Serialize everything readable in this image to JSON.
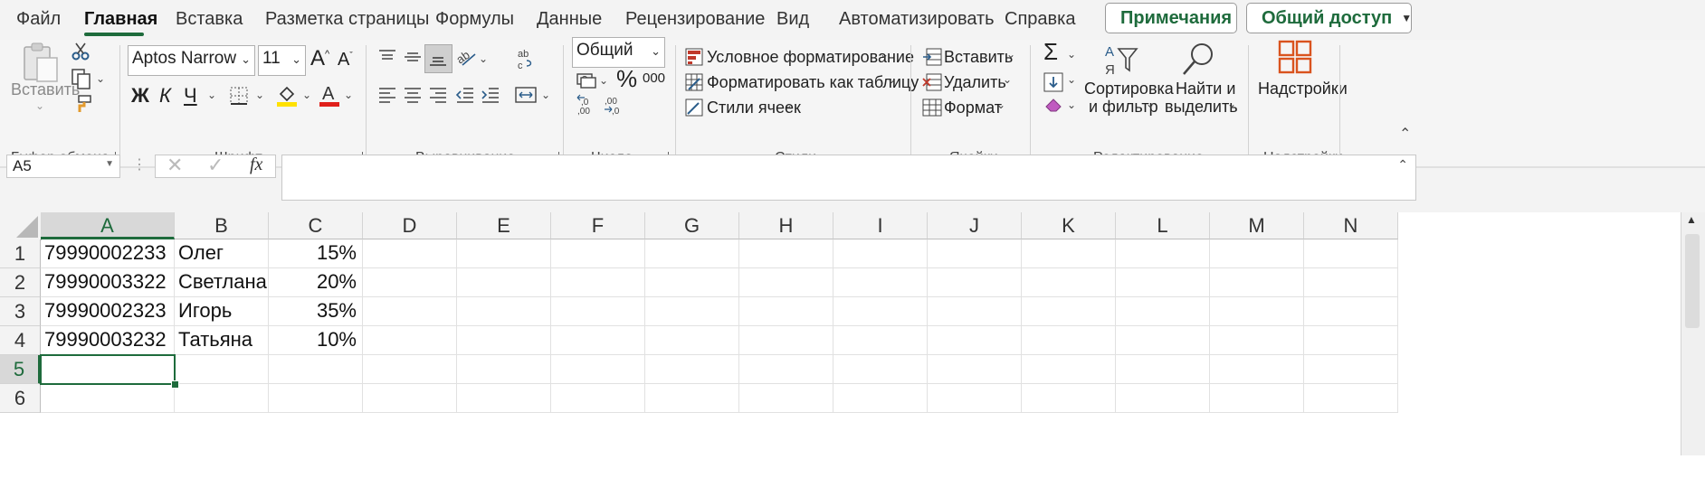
{
  "tabs": [
    "Файл",
    "Главная",
    "Вставка",
    "Разметка страницы",
    "Формулы",
    "Данные",
    "Рецензирование",
    "Вид",
    "Автоматизировать",
    "Справка"
  ],
  "active_tab": "Главная",
  "top_buttons": {
    "comments": "Примечания",
    "share": "Общий доступ"
  },
  "ribbon": {
    "clipboard": {
      "paste_label": "Вставить",
      "group": "Буфер обмена"
    },
    "font": {
      "name": "Aptos Narrow",
      "size": "11",
      "bold": "Ж",
      "italic": "К",
      "underline": "Ч",
      "group": "Шрифт"
    },
    "alignment": {
      "group": "Выравнивание"
    },
    "number": {
      "format": "Общий",
      "percent": "%",
      "thousands": "000",
      "group": "Число"
    },
    "styles": {
      "conditional": "Условное форматирование",
      "as_table": "Форматировать как таблицу",
      "cell_styles": "Стили ячеек",
      "group": "Стили"
    },
    "cells": {
      "insert": "Вставить",
      "delete": "Удалить",
      "format": "Формат",
      "group": "Ячейки"
    },
    "editing": {
      "sort_line1": "Сортировка",
      "sort_line2": "и фильтр",
      "find_line1": "Найти и",
      "find_line2": "выделить",
      "group": "Редактирование"
    },
    "addins": {
      "label": "Надстройки",
      "group": "Надстройки"
    }
  },
  "formula_bar": {
    "name_box": "A5",
    "fx": "fx",
    "formula": ""
  },
  "columns": [
    "A",
    "B",
    "C",
    "D",
    "E",
    "F",
    "G",
    "H",
    "I",
    "J",
    "K",
    "L",
    "M",
    "N"
  ],
  "rows": [
    {
      "num": "1",
      "a": "79990002233",
      "b": "Олег",
      "c": "15%"
    },
    {
      "num": "2",
      "a": "79990003322",
      "b": "Светлана",
      "c": "20%"
    },
    {
      "num": "3",
      "a": "79990002323",
      "b": "Игорь",
      "c": "35%"
    },
    {
      "num": "4",
      "a": "79990003232",
      "b": "Татьяна",
      "c": "10%"
    },
    {
      "num": "5",
      "a": "",
      "b": "",
      "c": ""
    },
    {
      "num": "6",
      "a": "",
      "b": "",
      "c": ""
    }
  ],
  "selected_cell": "A5",
  "colors": {
    "accent": "#1e6b3c",
    "conditional_red": "#c0392b",
    "fill_yellow": "#ffe100",
    "font_red": "#e0201b",
    "addins_orange": "#d9531e"
  }
}
